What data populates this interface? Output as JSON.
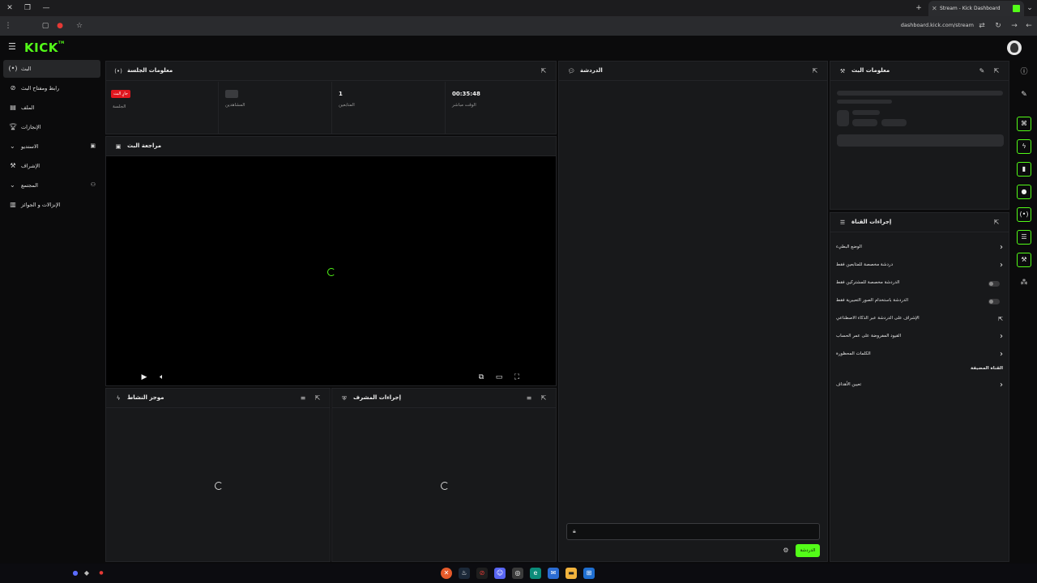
{
  "browser": {
    "tab_title": "Stream - Kick Dashboard",
    "url": "dashboard.kick.com/stream"
  },
  "app": {
    "logo": "KICK",
    "logo_super": "TM"
  },
  "sidebar": {
    "items": [
      {
        "label": "البث",
        "icon": "broadcast-icon"
      },
      {
        "label": "رابط ومفتاح البث",
        "icon": "link-icon"
      },
      {
        "label": "الملف",
        "icon": "profile-icon"
      },
      {
        "label": "الإنجازات",
        "icon": "trophy-icon"
      },
      {
        "label": "الاستديو",
        "icon": "studio-icon"
      },
      {
        "label": "الإشراف",
        "icon": "moderation-icon"
      },
      {
        "label": "المجتمع",
        "icon": "community-icon"
      },
      {
        "label": "الإنزالات و الجوائز",
        "icon": "drops-icon"
      }
    ]
  },
  "session": {
    "title": "معلومات الجلسة",
    "live_badge": "جارٍ البث",
    "stats": [
      {
        "value": "",
        "label": "الجلسة"
      },
      {
        "value": "",
        "label": "المشاهدين"
      },
      {
        "value": "1",
        "label": "المتابعين"
      },
      {
        "value": "00:35:48",
        "label": "الوقت مباشر"
      }
    ]
  },
  "preview": {
    "title": "مراجعة البث"
  },
  "activity": {
    "title": "موجز النشاط"
  },
  "mod_actions": {
    "title": "إجراءات المشرف"
  },
  "chat": {
    "title": "الدردشة",
    "send_label": "الدردشة"
  },
  "stream_info": {
    "title": "معلومات البث"
  },
  "channel_actions": {
    "title": "إجراءات القناة",
    "rows": [
      {
        "label": "الوضع البطيء",
        "control": "chevron"
      },
      {
        "label": "دردشة مخصصة للمتابعين فقط",
        "control": "chevron"
      },
      {
        "label": "الدردشة مخصصة للمشتركين فقط",
        "control": "toggle"
      },
      {
        "label": "الدردشة باستخدام الصور التعبيرية فقط",
        "control": "toggle"
      },
      {
        "label": "الإشراف على الدردشة عبر الذكاء الاصطناعي",
        "control": "external"
      },
      {
        "label": "القيود المفروضة على عمر الحساب",
        "control": "chevron"
      },
      {
        "label": "الكلمات المحظورة",
        "control": "chevron"
      }
    ],
    "section_label": "القناة المضيفة",
    "goals_label": "تعيين الأهداف"
  },
  "colors": {
    "accent": "#53fc18",
    "live": "#e0161e",
    "panel": "#18191b",
    "background": "#0b0b0c"
  }
}
